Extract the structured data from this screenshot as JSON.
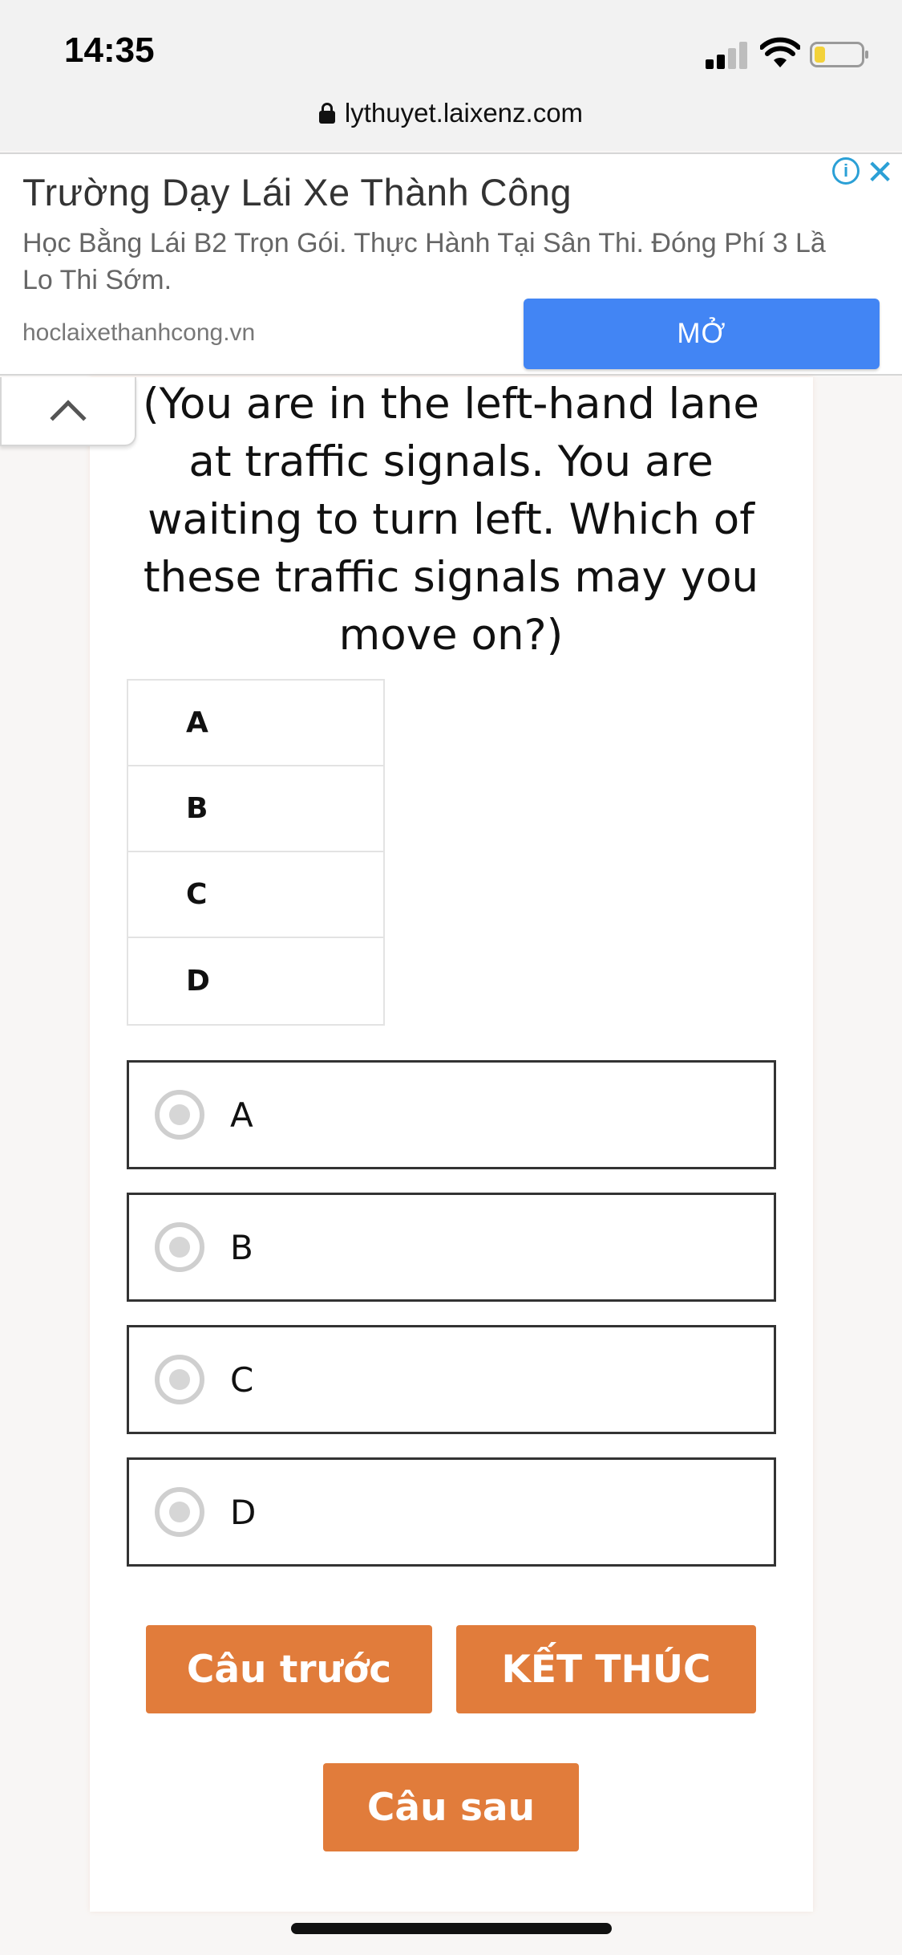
{
  "status_bar": {
    "time": "14:35"
  },
  "browser": {
    "url": "lythuyet.laixenz.com"
  },
  "ad": {
    "title": "Trường Dạy Lái Xe Thành Công",
    "description_line1": "Học Bằng Lái B2 Trọn Gói. Thực Hành Tại Sân Thi. Đóng Phí 3 Lầ",
    "description_line2": "Lo Thi Sớm.",
    "domain": "hoclaixethanhcong.vn",
    "open_label": "MỞ",
    "info_label": "i",
    "close_label": "✕"
  },
  "question": {
    "text": "(You are in the left-hand lane at traffic signals. You are waiting to turn left. Which of these traffic signals may you move on?)",
    "table_options": [
      "A",
      "B",
      "C",
      "D"
    ]
  },
  "answers": [
    {
      "label": "A",
      "selected": false
    },
    {
      "label": "B",
      "selected": false
    },
    {
      "label": "C",
      "selected": false
    },
    {
      "label": "D",
      "selected": false
    }
  ],
  "buttons": {
    "previous": "Câu trước",
    "finish": "KẾT THÚC",
    "next": "Câu sau"
  },
  "colors": {
    "accent": "#e17c3b",
    "ad_button": "#4285f4",
    "ad_icon": "#2ba0d6"
  }
}
